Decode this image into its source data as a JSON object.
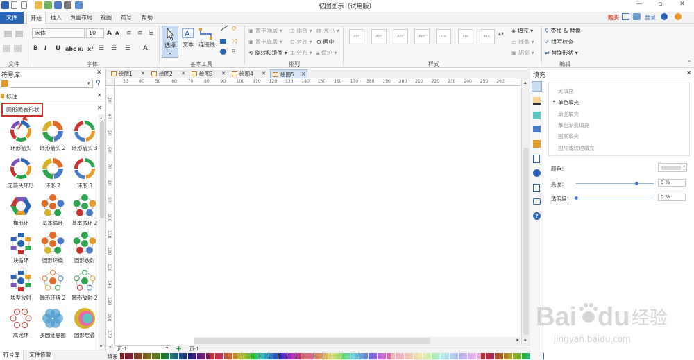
{
  "window": {
    "title": "亿图图示（试用版）",
    "min": "—",
    "max": "▫",
    "close": "✕"
  },
  "menu": {
    "file": "文件",
    "tabs": [
      "开始",
      "插入",
      "页面布局",
      "视图",
      "符号",
      "帮助"
    ],
    "buy": "购买",
    "login": "登录"
  },
  "ribbon": {
    "font_name": "宋体",
    "font_size": "10",
    "groups": {
      "file": "文件",
      "font": "字体",
      "basic": "基本工具",
      "arrange": "排列",
      "style": "样式",
      "edit": "编辑"
    },
    "tools": {
      "select": "选择",
      "text": "文本",
      "connector": "连接线"
    },
    "arrange": {
      "bring_front": "置于顶层",
      "send_back": "置于底层",
      "rotate_flip": "旋转和镜像",
      "group": "组合",
      "align": "对齐",
      "distribute": "分布",
      "size": "大小",
      "center": "居中",
      "protect": "保护"
    },
    "style_sample": "Abc",
    "fill": "填充",
    "line": "线条",
    "shadow": "阴影",
    "edit": {
      "find_replace": "查找 & 替换",
      "spell_check": "拼写检查",
      "replace_shape": "替换形状"
    }
  },
  "library": {
    "title": "符号库",
    "sections": [
      "标注",
      "圆形图表形状"
    ],
    "shapes": [
      {
        "label": "环形箭头"
      },
      {
        "label": "环形箭头 2"
      },
      {
        "label": "环形箭头 3"
      },
      {
        "label": "无箭头环形"
      },
      {
        "label": "环形 2"
      },
      {
        "label": "环形 3"
      },
      {
        "label": "梯形环"
      },
      {
        "label": "基本循环"
      },
      {
        "label": "基本循环 2"
      },
      {
        "label": "块循环"
      },
      {
        "label": "圆形环绕"
      },
      {
        "label": "圆形放射"
      },
      {
        "label": "块型放射"
      },
      {
        "label": "圆形环绕 2"
      },
      {
        "label": "圆形放射 2"
      },
      {
        "label": "高光环"
      },
      {
        "label": "多圆维恩图"
      },
      {
        "label": "圆形层叠"
      }
    ],
    "bottom_tabs": [
      "符号库",
      "文件恢复"
    ]
  },
  "documents": {
    "tabs": [
      "绘图1",
      "绘图2",
      "绘图3",
      "绘图4",
      "绘图5"
    ],
    "active_tab": 4,
    "ruler_h": [
      "30",
      "40",
      "50",
      "60",
      "70",
      "80",
      "90",
      "100",
      "110",
      "120",
      "130",
      "140",
      "150",
      "160",
      "170",
      "180",
      "190",
      "200",
      "210",
      "220",
      "230",
      "240",
      "250",
      "260"
    ],
    "ruler_v": [
      "30",
      "40",
      "50",
      "60",
      "70",
      "80",
      "90",
      "100",
      "110",
      "120",
      "130",
      "140",
      "150",
      "160",
      "170"
    ],
    "page_select": "页-1",
    "page_tab": "页-1",
    "palette_label": "填充"
  },
  "fill_panel": {
    "title": "填充",
    "options": [
      "无填充",
      "单色填充",
      "渐变填充",
      "单色渐变填充",
      "图案填充",
      "图片或纹理填充"
    ],
    "selected": 1,
    "color_label": "颜色：",
    "brightness_label": "亮度：",
    "brightness_value": "0 %",
    "brightness_fraction": 0.78,
    "transparency_label": "透明度：",
    "transparency_value": "0 %",
    "transparency_fraction": 0.0
  },
  "watermark": {
    "text": "Bai",
    "paw": "du",
    "cn": "经验",
    "url": "jingyan.baidu.com"
  },
  "colors": {
    "accent": "#2b63b5",
    "highlight": "#c8312c"
  }
}
